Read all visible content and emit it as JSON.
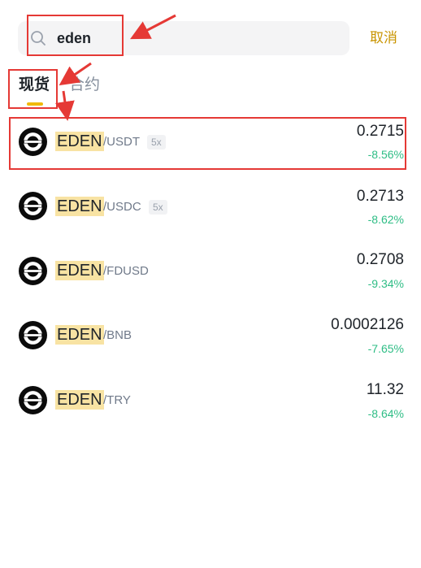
{
  "search": {
    "query": "eden",
    "cancel_label": "取消"
  },
  "tabs": [
    {
      "label": "现货"
    },
    {
      "label": "合约"
    }
  ],
  "results": [
    {
      "base": "EDEN",
      "quote": "/USDT",
      "leverage": "5x",
      "price": "0.2715",
      "change": "-8.56%"
    },
    {
      "base": "EDEN",
      "quote": "/USDC",
      "leverage": "5x",
      "price": "0.2713",
      "change": "-8.62%"
    },
    {
      "base": "EDEN",
      "quote": "/FDUSD",
      "price": "0.2708",
      "change": "-9.34%"
    },
    {
      "base": "EDEN",
      "quote": "/BNB",
      "price": "0.0002126",
      "change": "-7.65%"
    },
    {
      "base": "EDEN",
      "quote": "/TRY",
      "price": "11.32",
      "change": "-8.64%"
    }
  ],
  "colors": {
    "accent": "#f0b90b",
    "cancel": "#c99400",
    "highlight": "#f8e3a3",
    "negative_change": "#2ebd85",
    "annotation": "#e53935"
  },
  "icons": {
    "search": "search-icon",
    "coin": "eden-coin-icon"
  }
}
